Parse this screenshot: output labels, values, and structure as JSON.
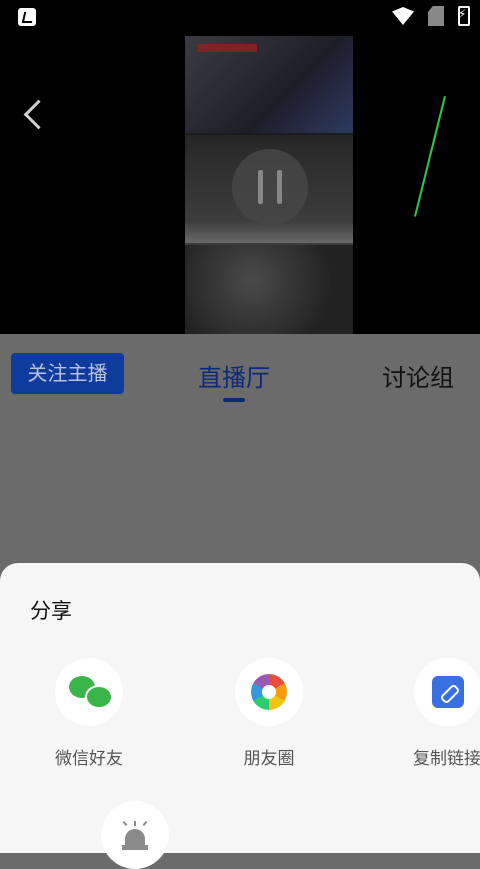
{
  "tabs": {
    "follow_label": "关注主播",
    "live_label": "直播厅",
    "discuss_label": "讨论组"
  },
  "share": {
    "title": "分享",
    "items": [
      {
        "label": "微信好友",
        "icon": "wechat-icon"
      },
      {
        "label": "朋友圈",
        "icon": "moments-icon"
      },
      {
        "label": "复制链接",
        "icon": "link-icon"
      },
      {
        "label": "",
        "icon": "alarm-icon"
      }
    ]
  },
  "colors": {
    "accent": "#0b2a7a",
    "follow_button": "#0e3b9c",
    "overlay": "#6b6b6b",
    "sheet": "#f6f6f6"
  }
}
